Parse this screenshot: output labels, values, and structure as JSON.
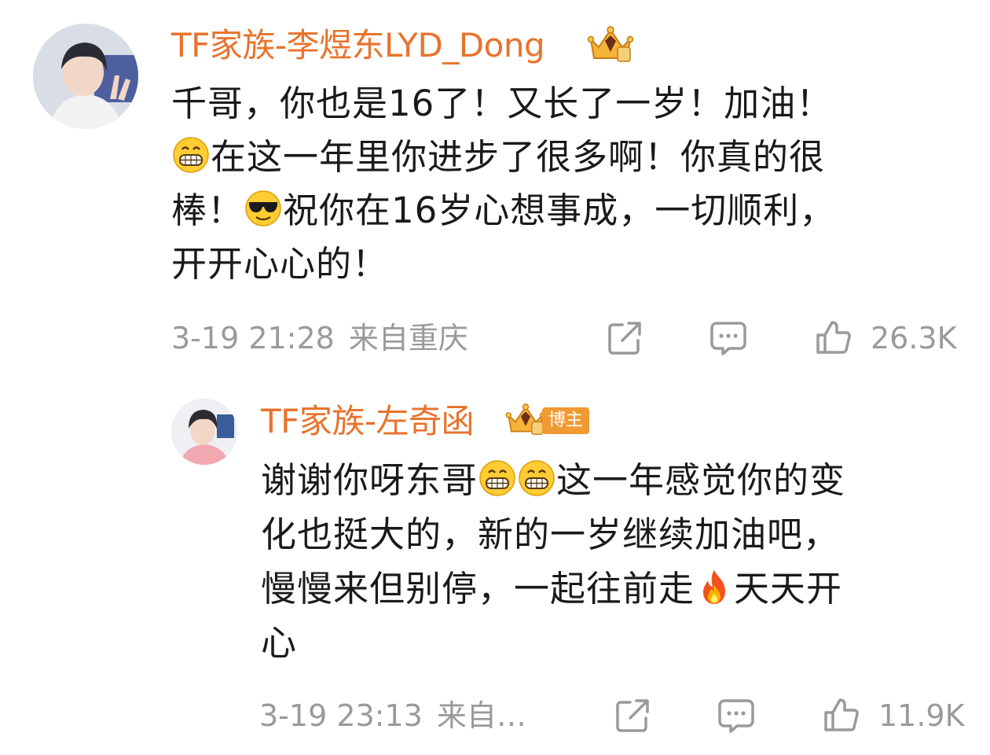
{
  "comment": {
    "username": "TF家族-李煜东LYD_Dong",
    "avatar_icon": "user-avatar",
    "badge_icon": "crown-icon",
    "text_lines": [
      [
        "千哥，你也是16了！又长了一岁！加油！"
      ],
      [
        "",
        "在这一年里你进步了很多啊！你真的很"
      ],
      [
        "棒！",
        "祝你在16岁心想事成，一切顺利，"
      ],
      [
        "开开心心的！"
      ]
    ],
    "emojis": [
      "grin-emoji",
      "cool-emoji"
    ],
    "time": "3-19 21:28",
    "location": "来自重庆",
    "likes": "26.3K"
  },
  "reply": {
    "username": "TF家族-左奇函",
    "avatar_icon": "user-avatar",
    "badge_icon": "crown-icon",
    "blogger_tag": "博主",
    "text_lines": [
      [
        "谢谢你呀东哥",
        "",
        "这一年感觉你的变"
      ],
      [
        "化也挺大的，新的一岁继续加油吧，"
      ],
      [
        "慢慢来但别停，一起往前走",
        "天天开"
      ],
      [
        "心"
      ]
    ],
    "emojis": [
      "grin-emoji",
      "grin-emoji",
      "fire-emoji"
    ],
    "time": "3-19 23:13",
    "location": "来自…",
    "likes": "11.9K"
  },
  "icons": {
    "share": "share-icon",
    "comment": "comment-icon",
    "like": "thumbs-up-icon"
  },
  "colors": {
    "username": "#e8732c",
    "meta_text": "#9a9a9a",
    "body_text": "#1a1a1a",
    "blogger_tag_bg": "#f09a32"
  }
}
